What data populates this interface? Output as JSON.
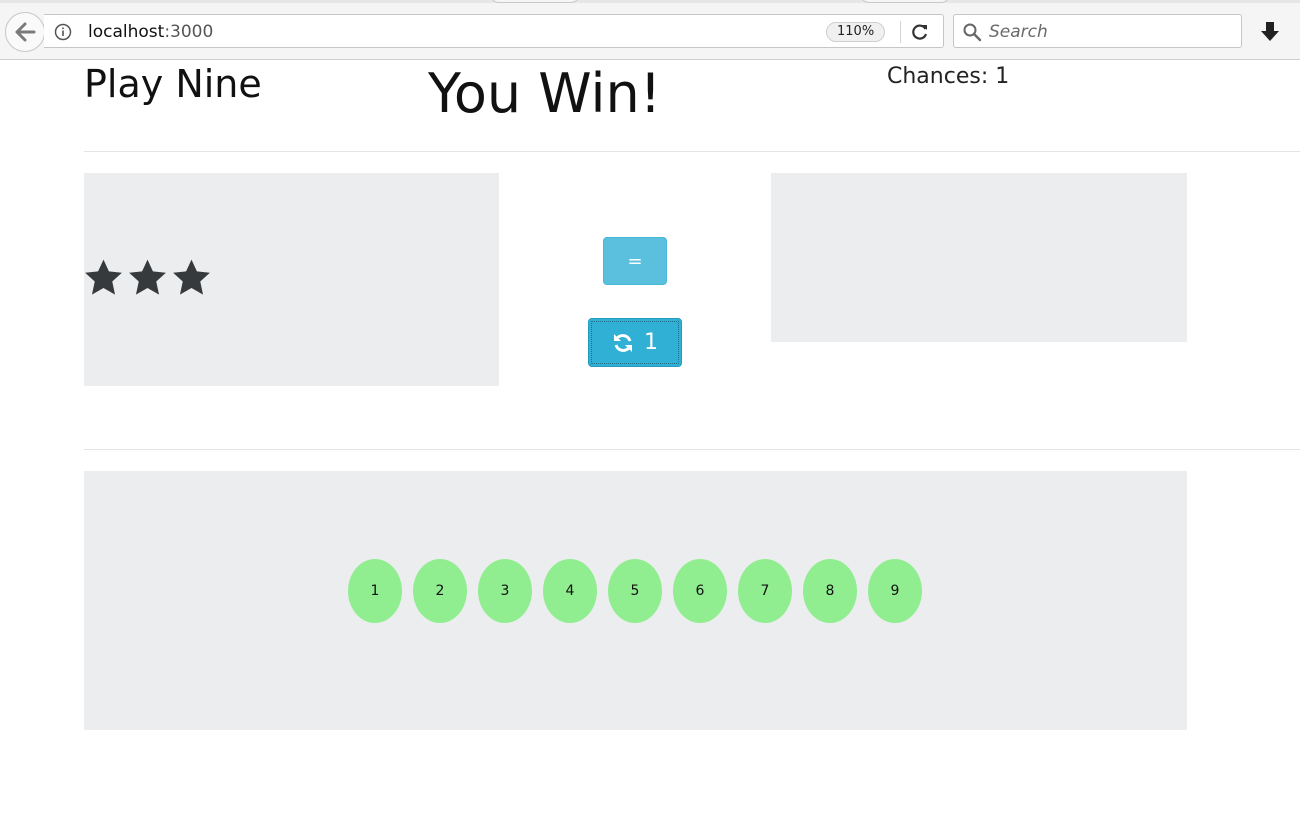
{
  "browser": {
    "url_host": "localhost",
    "url_port": ":3000",
    "zoom": "110%",
    "search_placeholder": "Search"
  },
  "header": {
    "title": "Play Nine",
    "message": "You Win!",
    "chances_label": "Chances: 1"
  },
  "stars": {
    "count": 3,
    "color": "#373a3c"
  },
  "controls": {
    "equals_label": "=",
    "redraw_count": "1",
    "info_color": "#5bc0de"
  },
  "numbers": {
    "items": [
      "1",
      "2",
      "3",
      "4",
      "5",
      "6",
      "7",
      "8",
      "9"
    ],
    "used_color": "#90ee90"
  }
}
